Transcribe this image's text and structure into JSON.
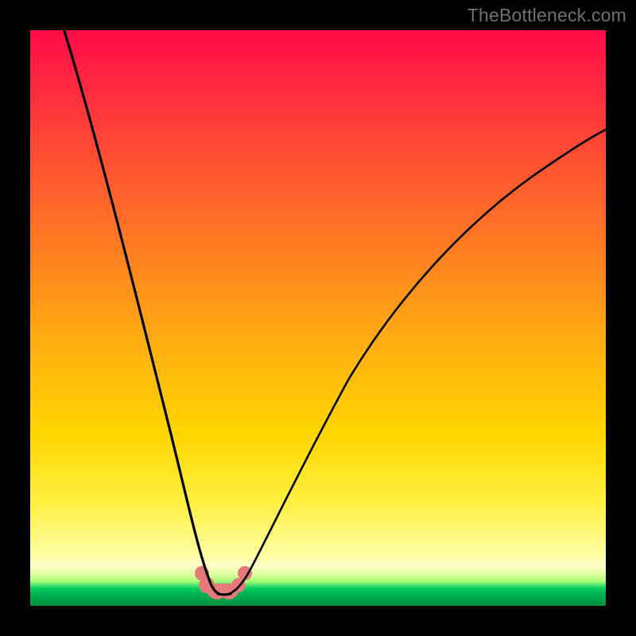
{
  "watermark": "TheBottleneck.com",
  "chart_data": {
    "type": "line",
    "title": "",
    "xlabel": "",
    "ylabel": "",
    "xlim": [
      0,
      100
    ],
    "ylim": [
      0,
      100
    ],
    "series": [
      {
        "name": "bottleneck-curve",
        "x": [
          6,
          10,
          14,
          18,
          21,
          24,
          26,
          28,
          29.5,
          30.5,
          31,
          31.5,
          32,
          33,
          34,
          35,
          36,
          37,
          38.5,
          41,
          45,
          50,
          56,
          63,
          72,
          82,
          92,
          100
        ],
        "y": [
          100,
          88,
          75,
          62,
          50,
          38,
          28,
          19,
          12,
          7,
          4,
          2.5,
          2,
          2,
          2.2,
          3,
          5,
          8,
          13,
          22,
          34,
          45,
          55,
          64,
          73,
          80,
          85,
          89
        ]
      }
    ],
    "annotations": [
      {
        "name": "minimum-marker",
        "x": 32.5,
        "y": 2
      }
    ],
    "background_gradient": {
      "top_color": "#ff0b47",
      "mid_color": "#ffd500",
      "bottom_band_color": "#00c058"
    }
  }
}
